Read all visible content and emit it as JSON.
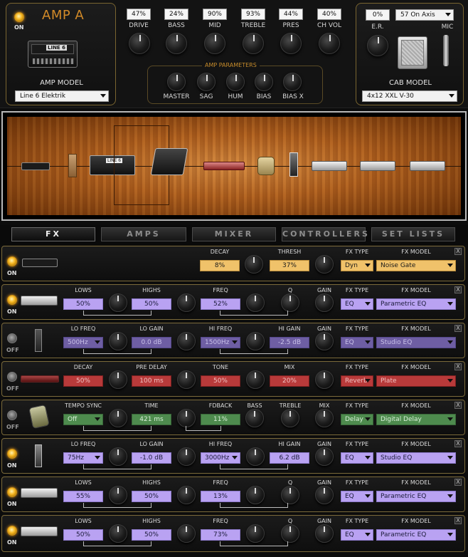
{
  "amp": {
    "power_label": "ON",
    "title": "AMP A",
    "model_label": "AMP MODEL",
    "model_value": "Line 6 Elektrik",
    "knobs": [
      {
        "label": "DRIVE",
        "value": "47%"
      },
      {
        "label": "BASS",
        "value": "24%"
      },
      {
        "label": "MID",
        "value": "90%"
      },
      {
        "label": "TREBLE",
        "value": "93%"
      },
      {
        "label": "PRES",
        "value": "44%"
      },
      {
        "label": "CH VOL",
        "value": "40%"
      }
    ],
    "params_title": "AMP PARAMETERS",
    "params": [
      "MASTER",
      "SAG",
      "HUM",
      "BIAS",
      "BIAS X"
    ],
    "er_label": "E.R.",
    "er_value": "0%",
    "mic_label": "MIC",
    "mic_value": "57 On Axis",
    "cab_label": "CAB MODEL",
    "cab_value": "4x12 XXL V-30",
    "amp_logo": "LINE 6"
  },
  "tabs": [
    "FX",
    "AMPS",
    "MIXER",
    "CONTROLLERS",
    "SET LISTS"
  ],
  "active_tab": "FX",
  "fx_rows": [
    {
      "power": "ON",
      "params": [
        {
          "label": "DECAY",
          "value": "8%"
        },
        {
          "label": "THRESH",
          "value": "37%"
        }
      ],
      "type": "Dyn",
      "model": "Noise Gate"
    },
    {
      "power": "ON",
      "params": [
        {
          "label": "LOWS",
          "value": "50%"
        },
        {
          "label": "HIGHS",
          "value": "50%"
        },
        {
          "label": "FREQ",
          "value": "52%"
        },
        {
          "label": "Q"
        },
        {
          "label": "GAIN"
        }
      ],
      "type": "EQ",
      "model": "Parametric EQ"
    },
    {
      "power": "OFF",
      "params": [
        {
          "label": "LO FREQ",
          "value": "500Hz"
        },
        {
          "label": "LO GAIN",
          "value": "0.0 dB"
        },
        {
          "label": "HI FREQ",
          "value": "1500Hz"
        },
        {
          "label": "HI GAIN",
          "value": "-2.5 dB"
        },
        {
          "label": "GAIN"
        }
      ],
      "type": "EQ",
      "model": "Studio EQ"
    },
    {
      "power": "OFF",
      "params": [
        {
          "label": "DECAY",
          "value": "50%"
        },
        {
          "label": "PRE DELAY",
          "value": "100 ms"
        },
        {
          "label": "TONE",
          "value": "50%"
        },
        {
          "label": "MIX",
          "value": "20%"
        }
      ],
      "type": "Reverb",
      "model": "Plate"
    },
    {
      "power": "OFF",
      "params": [
        {
          "label": "TEMPO SYNC",
          "value": "Off"
        },
        {
          "label": "TIME",
          "value": "421 ms"
        },
        {
          "label": "FDBACK",
          "value": "11%"
        },
        {
          "label": "BASS"
        },
        {
          "label": "TREBLE"
        },
        {
          "label": "MIX"
        }
      ],
      "type": "Delay",
      "model": "Digital Delay"
    },
    {
      "power": "ON",
      "params": [
        {
          "label": "LO FREQ",
          "value": "75Hz"
        },
        {
          "label": "LO GAIN",
          "value": "-1.0 dB"
        },
        {
          "label": "HI FREQ",
          "value": "3000Hz"
        },
        {
          "label": "HI GAIN",
          "value": "6.2 dB"
        },
        {
          "label": "GAIN"
        }
      ],
      "type": "EQ",
      "model": "Studio EQ"
    },
    {
      "power": "ON",
      "params": [
        {
          "label": "LOWS",
          "value": "55%"
        },
        {
          "label": "HIGHS",
          "value": "50%"
        },
        {
          "label": "FREQ",
          "value": "13%"
        },
        {
          "label": "Q"
        },
        {
          "label": "GAIN"
        }
      ],
      "type": "EQ",
      "model": "Parametric EQ"
    },
    {
      "power": "ON",
      "params": [
        {
          "label": "LOWS",
          "value": "50%"
        },
        {
          "label": "HIGHS",
          "value": "50%"
        },
        {
          "label": "FREQ",
          "value": "73%"
        },
        {
          "label": "Q"
        },
        {
          "label": "GAIN"
        }
      ],
      "type": "EQ",
      "model": "Parametric EQ"
    }
  ],
  "fx_headers": {
    "type": "FX TYPE",
    "model": "FX MODEL",
    "close": "X"
  }
}
